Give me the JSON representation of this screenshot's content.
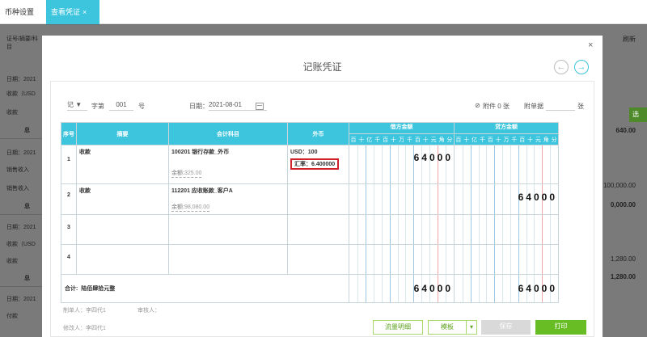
{
  "tabs": [
    {
      "label": "币种设置",
      "close": "×"
    },
    {
      "label": "查看凭证",
      "close": "×"
    }
  ],
  "background": {
    "left_lines": [
      "证号/摘要/科目",
      "日期：2021",
      "收款（USD",
      "收款",
      "总",
      "日期：2021",
      "销售收入",
      "销售收入",
      "总",
      "日期：2021",
      "收款（USD",
      "收款",
      "总",
      "日期：2021",
      "付款"
    ],
    "right_values": [
      "640.00",
      "100,000.00",
      "0,000.00",
      "1,280.00",
      "1,280.00"
    ],
    "refresh_label": "刷新",
    "side_tab": "选"
  },
  "modal": {
    "title": "记账凭证",
    "close": "×",
    "prev_icon": "←",
    "next_icon": "→"
  },
  "voucher_meta": {
    "word": "记",
    "word_label": "字第",
    "number": "001",
    "number_unit": "号",
    "date_label": "日期：",
    "date": "2021-08-01",
    "attachment_label": "附件 0 张",
    "attachment_docs_label": "附单据",
    "attachment_unit": "张"
  },
  "table": {
    "headers": {
      "seq": "序号",
      "summary": "摘要",
      "account": "会计科目",
      "currency": "外币",
      "debit": "借方金额",
      "credit": "贷方金额"
    },
    "digit_units": [
      "百",
      "十",
      "亿",
      "千",
      "百",
      "十",
      "万",
      "千",
      "百",
      "十",
      "元",
      "角",
      "分"
    ],
    "rows": [
      {
        "seq": "1",
        "summary": "收款",
        "account": "100201 银行存款_外币",
        "balance_label": "余额:",
        "balance": "325.00",
        "currency": "USD：100",
        "rate": "汇率：6.400000",
        "debit": "64000",
        "credit": ""
      },
      {
        "seq": "2",
        "summary": "收款",
        "account": "112201 应收账款_客户A",
        "balance_label": "余额:",
        "balance": "98,080.00",
        "currency": "",
        "rate": "",
        "debit": "",
        "credit": "64000"
      },
      {
        "seq": "3",
        "summary": "",
        "account": "",
        "balance_label": "",
        "balance": "",
        "currency": "",
        "rate": "",
        "debit": "",
        "credit": ""
      },
      {
        "seq": "4",
        "summary": "",
        "account": "",
        "balance_label": "",
        "balance": "",
        "currency": "",
        "rate": "",
        "debit": "",
        "credit": ""
      }
    ],
    "total": {
      "label": "合计:",
      "words": "陆佰肆拾元整",
      "debit": "64000",
      "credit": "64000"
    }
  },
  "footer": {
    "maker": "制单人：李四代1",
    "auditor": "审核人：",
    "modifier": "修改人：李四代1",
    "buttons": {
      "cashflow": "流量明细",
      "template": "模板",
      "template_arrow": "▾",
      "save": "保存",
      "print": "打印"
    }
  },
  "colors": {
    "accent": "#3dc5de",
    "green": "#68bd25",
    "highlight": "#d0222a"
  }
}
